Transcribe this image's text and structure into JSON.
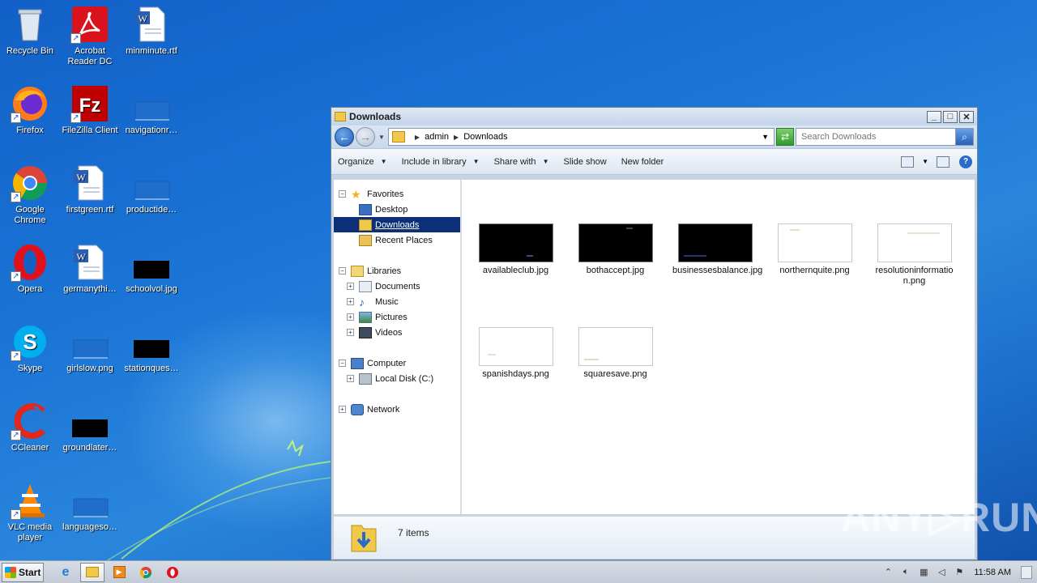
{
  "desktop": {
    "icons": [
      {
        "label": "Recycle Bin"
      },
      {
        "label": "Acrobat Reader DC"
      },
      {
        "label": "minminute.rtf"
      },
      {
        "label": "Firefox"
      },
      {
        "label": "FileZilla Client"
      },
      {
        "label": "navigationr…"
      },
      {
        "label": "Google Chrome"
      },
      {
        "label": "firstgreen.rtf"
      },
      {
        "label": "productide…"
      },
      {
        "label": "Opera"
      },
      {
        "label": "germanythi…"
      },
      {
        "label": "schoolvol.jpg"
      },
      {
        "label": "Skype"
      },
      {
        "label": "girlslow.png"
      },
      {
        "label": "stationques…"
      },
      {
        "label": "CCleaner"
      },
      {
        "label": "groundlater…"
      },
      {
        "label": "VLC media player"
      },
      {
        "label": "languageso…"
      }
    ]
  },
  "window": {
    "title": "Downloads",
    "controls": {
      "minimize": "_",
      "maximize": "□",
      "close": "✕"
    },
    "address": {
      "crumbs": [
        "admin",
        "Downloads"
      ]
    },
    "search": {
      "placeholder": "Search Downloads"
    },
    "commands": [
      {
        "label": "Organize",
        "dropdown": true
      },
      {
        "label": "Include in library",
        "dropdown": true
      },
      {
        "label": "Share with",
        "dropdown": true
      },
      {
        "label": "Slide show",
        "dropdown": false
      },
      {
        "label": "New folder",
        "dropdown": false
      }
    ],
    "nav": {
      "favorites": "Favorites",
      "desktop": "Desktop",
      "downloads": "Downloads",
      "recent": "Recent Places",
      "libraries": "Libraries",
      "documents": "Documents",
      "music": "Music",
      "pictures": "Pictures",
      "videos": "Videos",
      "computer": "Computer",
      "localdisk": "Local Disk (C:)",
      "network": "Network"
    },
    "files": [
      {
        "name": "availableclub.jpg",
        "thumb": "dark"
      },
      {
        "name": "bothaccept.jpg",
        "thumb": "dark"
      },
      {
        "name": "businessesbalance.jpg",
        "thumb": "dark"
      },
      {
        "name": "northernquite.png",
        "thumb": "light"
      },
      {
        "name": "resolutioninformation.png",
        "thumb": "light"
      },
      {
        "name": "spanishdays.png",
        "thumb": "light"
      },
      {
        "name": "squaresave.png",
        "thumb": "light"
      }
    ],
    "status": {
      "count": "7 items"
    }
  },
  "taskbar": {
    "start_label": "Start",
    "clock": "11:58 AM"
  },
  "watermark": "ANY▷RUN"
}
